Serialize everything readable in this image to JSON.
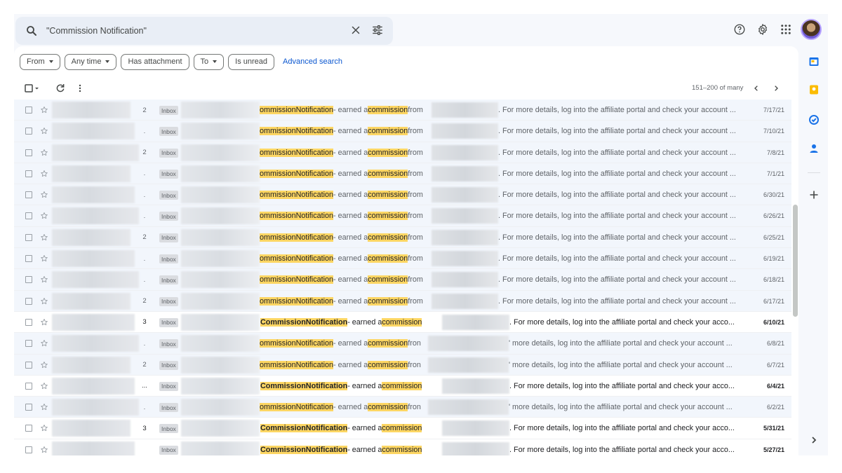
{
  "search": {
    "query": "\"Commission Notification\""
  },
  "filters": {
    "chips": [
      {
        "label": "From",
        "dropdown": true
      },
      {
        "label": "Any time",
        "dropdown": true
      },
      {
        "label": "Has attachment",
        "dropdown": false
      },
      {
        "label": "To",
        "dropdown": true
      },
      {
        "label": "Is unread",
        "dropdown": false
      }
    ],
    "advanced_search": "Advanced search"
  },
  "toolbar": {
    "pagination": "151–200 of many"
  },
  "messages": [
    {
      "count": "2",
      "label": "Inbox",
      "unread": false,
      "date": "7/17/21",
      "style": "a"
    },
    {
      "count": ".",
      "label": "Inbox",
      "unread": false,
      "date": "7/10/21",
      "style": "a"
    },
    {
      "count": "2",
      "label": "Inbox",
      "unread": false,
      "date": "7/8/21",
      "style": "a"
    },
    {
      "count": ".",
      "label": "Inbox",
      "unread": false,
      "date": "7/1/21",
      "style": "a"
    },
    {
      "count": ".",
      "label": "Inbox",
      "unread": false,
      "date": "6/30/21",
      "style": "a"
    },
    {
      "count": ".",
      "label": "Inbox",
      "unread": false,
      "date": "6/26/21",
      "style": "a"
    },
    {
      "count": "2",
      "label": "Inbox",
      "unread": false,
      "date": "6/25/21",
      "style": "a"
    },
    {
      "count": ".",
      "label": "Inbox",
      "unread": false,
      "date": "6/19/21",
      "style": "a"
    },
    {
      "count": ".",
      "label": "Inbox",
      "unread": false,
      "date": "6/18/21",
      "style": "a"
    },
    {
      "count": "2",
      "label": "Inbox",
      "unread": false,
      "date": "6/17/21",
      "style": "a"
    },
    {
      "count": "3",
      "label": "Inbox",
      "unread": true,
      "date": "6/10/21",
      "style": "b"
    },
    {
      "count": ".",
      "label": "Inbox",
      "unread": false,
      "date": "6/8/21",
      "style": "c"
    },
    {
      "count": "2",
      "label": "Inbox",
      "unread": false,
      "date": "6/7/21",
      "style": "c"
    },
    {
      "count": "...",
      "label": "Inbox",
      "unread": true,
      "date": "6/4/21",
      "style": "b"
    },
    {
      "count": ".",
      "label": "Inbox",
      "unread": false,
      "date": "6/2/21",
      "style": "c"
    },
    {
      "count": "3",
      "label": "Inbox",
      "unread": true,
      "date": "5/31/21",
      "style": "b"
    },
    {
      "count": "",
      "label": "Inbox",
      "unread": true,
      "date": "5/27/21",
      "style": "b"
    }
  ],
  "snippet_parts": {
    "read_subject_a": "ommission",
    "read_subject_b": "Notification",
    "unread_subject_a": "Commission",
    "unread_subject_b": "Notification",
    "sep": " - earned a ",
    "hl_word": "commission",
    "from_a": " from",
    "from_c": " fron",
    "tail_a": ". For more details, log into the affiliate portal and check your account ...",
    "tail_b": ". For more details, log into the affiliate portal and check your acco...",
    "tail_c": "' more details, log into the affiliate portal and check your account ..."
  },
  "colors": {
    "highlight": "#fdd663",
    "link": "#0b57d0",
    "read_row": "#f2f6fc",
    "unread_row": "#ffffff"
  }
}
